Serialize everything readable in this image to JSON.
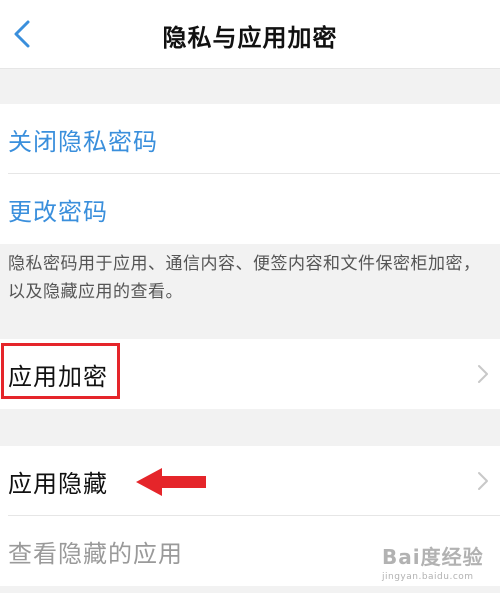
{
  "header": {
    "title": "隐私与应用加密"
  },
  "password_group": {
    "items": [
      {
        "label": "关闭隐私密码"
      },
      {
        "label": "更改密码"
      }
    ],
    "description": "隐私密码用于应用、通信内容、便签内容和文件保密柜加密，以及隐藏应用的查看。"
  },
  "encrypt_group": {
    "label": "应用加密"
  },
  "hide_group": {
    "items": [
      {
        "label": "应用隐藏"
      },
      {
        "label": "查看隐藏的应用"
      }
    ]
  },
  "watermark": {
    "brand": "Bai度经验",
    "url": "jingyan.baidu.com"
  },
  "colors": {
    "accent": "#3a8fdc",
    "highlight": "#e5252a",
    "background": "#f2f2f2"
  }
}
